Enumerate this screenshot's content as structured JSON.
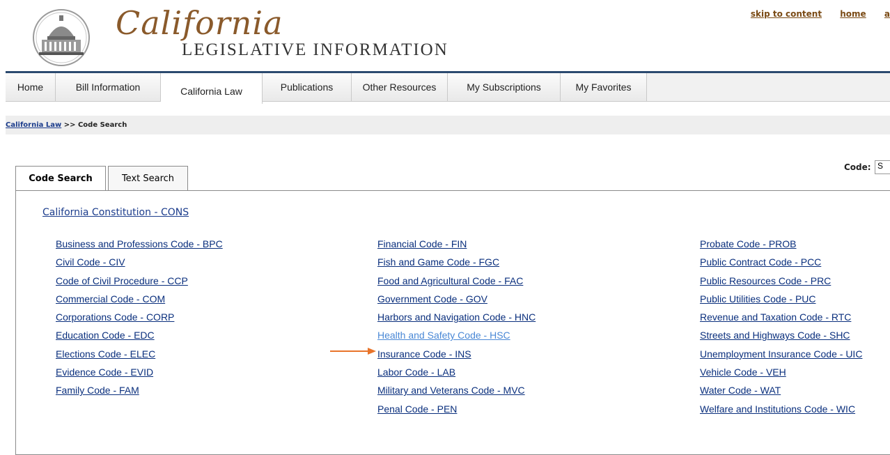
{
  "header": {
    "logo_script": "California",
    "logo_sub": "LEGISLATIVE INFORMATION",
    "utility_links": [
      "skip to content",
      "home",
      "a"
    ]
  },
  "nav": {
    "tabs": [
      "Home",
      "Bill Information",
      "California Law",
      "Publications",
      "Other Resources",
      "My Subscriptions",
      "My Favorites"
    ],
    "active": "California Law"
  },
  "breadcrumb": {
    "link": "California Law",
    "separator": " >> ",
    "current": "Code Search"
  },
  "code_filter": {
    "label": "Code:",
    "value": "S"
  },
  "subtabs": [
    "Code Search",
    "Text Search"
  ],
  "constitution_link": "California Constitution - CONS",
  "codes": {
    "col1": [
      "Business and Professions Code - BPC",
      "Civil Code - CIV",
      "Code of Civil Procedure - CCP",
      "Commercial Code - COM",
      "Corporations Code - CORP",
      "Education Code - EDC",
      "Elections Code - ELEC",
      "Evidence Code - EVID",
      "Family Code - FAM"
    ],
    "col2": [
      "Financial Code - FIN",
      "Fish and Game Code - FGC",
      "Food and Agricultural Code - FAC",
      "Government Code - GOV",
      "Harbors and Navigation Code - HNC",
      "Health and Safety Code - HSC",
      "Insurance Code - INS",
      "Labor Code - LAB",
      "Military and Veterans Code - MVC",
      "Penal Code - PEN"
    ],
    "col3": [
      "Probate Code - PROB",
      "Public Contract Code - PCC",
      "Public Resources Code - PRC",
      "Public Utilities Code - PUC",
      "Revenue and Taxation Code - RTC",
      "Streets and Highways Code - SHC",
      "Unemployment Insurance Code - UIC",
      "Vehicle Code - VEH",
      "Water Code - WAT",
      "Welfare and Institutions Code - WIC"
    ]
  },
  "highlighted_code": "Health and Safety Code - HSC",
  "colors": {
    "link": "#0a2f7d",
    "link_highlight": "#4a88d6",
    "arrow": "#e8742a",
    "nav_rule": "#2b4a6f",
    "logo_brown": "#8a5a2b"
  }
}
